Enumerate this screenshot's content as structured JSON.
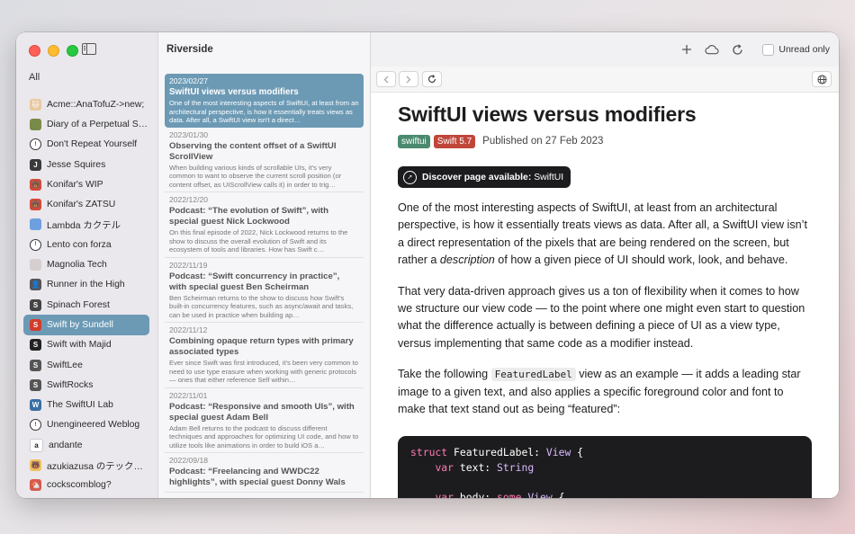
{
  "sidebar": {
    "all_label": "All",
    "feeds": [
      {
        "label": "Acme::AnaTofuZ->new;",
        "icon": "acme-icon",
        "color": "#e8c9a0",
        "glyph": "🐱"
      },
      {
        "label": "Diary of a Perpetual S…",
        "icon": "diary-icon",
        "color": "#7a8a4a",
        "glyph": ""
      },
      {
        "label": "Don't Repeat Yourself",
        "icon": "ring-icon",
        "color": "#ffffff",
        "glyph": "!"
      },
      {
        "label": "Jesse Squires",
        "icon": "jesse-icon",
        "color": "#3a3a3a",
        "glyph": "J"
      },
      {
        "label": "Konifar's WIP",
        "icon": "konifar-icon",
        "color": "#d34a3a",
        "glyph": "🐻"
      },
      {
        "label": "Konifar's ZATSU",
        "icon": "konifar-icon",
        "color": "#d34a3a",
        "glyph": "🐻"
      },
      {
        "label": "Lambda カクテル",
        "icon": "lambda-icon",
        "color": "#6ea0e0",
        "glyph": ""
      },
      {
        "label": "Lento con forza",
        "icon": "ring-icon",
        "color": "#ffffff",
        "glyph": "!"
      },
      {
        "label": "Magnolia Tech",
        "icon": "magnolia-icon",
        "color": "#d5cfcf",
        "glyph": ""
      },
      {
        "label": "Runner in the High",
        "icon": "runner-icon",
        "color": "#555555",
        "glyph": "👤"
      },
      {
        "label": "Spinach Forest",
        "icon": "spinach-icon",
        "color": "#444444",
        "glyph": "S"
      },
      {
        "label": "Swift by Sundell",
        "icon": "sundell-icon",
        "color": "#d33b2a",
        "glyph": "S"
      },
      {
        "label": "Swift with Majid",
        "icon": "majid-icon",
        "color": "#222222",
        "glyph": "S"
      },
      {
        "label": "SwiftLee",
        "icon": "swiftlee-icon",
        "color": "#555555",
        "glyph": "S"
      },
      {
        "label": "SwiftRocks",
        "icon": "swiftrocks-icon",
        "color": "#555555",
        "glyph": "S"
      },
      {
        "label": "The SwiftUI Lab",
        "icon": "wordpress-icon",
        "color": "#3a6ea5",
        "glyph": "W"
      },
      {
        "label": "Unengineered Weblog",
        "icon": "ring-icon",
        "color": "#ffffff",
        "glyph": "!"
      },
      {
        "label": "andante",
        "icon": "andante-icon",
        "color": "#ffffff",
        "glyph": "a"
      },
      {
        "label": "azukiazusa のテックブ…",
        "icon": "azuki-icon",
        "color": "#f0c060",
        "glyph": "🐻"
      },
      {
        "label": "cockscomblog?",
        "icon": "cockscomb-icon",
        "color": "#d55a4a",
        "glyph": "🐔"
      }
    ],
    "selected_index": 11
  },
  "list": {
    "title": "Riverside",
    "articles": [
      {
        "date": "2023/02/27",
        "title": "SwiftUI views versus modifiers",
        "summary": "One of the most interesting aspects of SwiftUI, at least from an architectural perspective, is how it essentially treats views as data. After all, a SwiftUI view isn't a direct…",
        "selected": true
      },
      {
        "date": "2023/01/30",
        "title": "Observing the content offset of a SwiftUI ScrollView",
        "summary": "When building various kinds of scrollable UIs, it's very common to want to observe the current scroll position (or content offset, as UIScrollView calls it) in order to trig…"
      },
      {
        "date": "2022/12/20",
        "title": "Podcast: “The evolution of Swift”, with special guest Nick Lockwood",
        "summary": "On this final episode of 2022, Nick Lockwood returns to the show to discuss the overall evolution of Swift and its ecosystem of tools and libraries. How has Swift c…"
      },
      {
        "date": "2022/11/19",
        "title": "Podcast: “Swift concurrency in practice”, with special guest Ben Scheirman",
        "summary": "Ben Scheirman returns to the show to discuss how Swift's built-in concurrency features, such as async/await and tasks, can be used in practice when building ap…"
      },
      {
        "date": "2022/11/12",
        "title": "Combining opaque return types with primary associated types",
        "summary": "Ever since Swift was first introduced, it's been very common to need to use type erasure when working with generic protocols — ones that either reference Self within…"
      },
      {
        "date": "2022/11/01",
        "title": "Podcast: “Responsive and smooth UIs”, with special guest Adam Bell",
        "summary": "Adam Bell returns to the podcast to discuss different techniques and approaches for optimizing UI code, and how to utilize tools like animations in order to build iOS a…"
      },
      {
        "date": "2022/09/18",
        "title": "Podcast: “Freelancing and WWDC22 highlights”, with special guest Donny Wals",
        "summary": ""
      }
    ]
  },
  "toolbar": {
    "unread_label": "Unread only",
    "icons": [
      "plus-icon",
      "cloud-icon",
      "refresh-icon"
    ]
  },
  "article": {
    "title": "SwiftUI views versus modifiers",
    "tags": [
      {
        "label": "swiftui",
        "color": "#4a8a6e"
      },
      {
        "label": "Swift 5.7",
        "color": "#c0463a"
      }
    ],
    "published": "Published on 27 Feb 2023",
    "discover_label": "Discover page available:",
    "discover_value": "SwiftUI",
    "p1_a": "One of the most interesting aspects of SwiftUI, at least from an architectural perspective, is how it essentially treats views as data. After all, a SwiftUI view isn’t a direct representation of the pixels that are being rendered on the screen, but rather a ",
    "p1_em": "description",
    "p1_b": " of how a given piece of UI should work, look, and behave.",
    "p2": "That very data-driven approach gives us a ton of flexibility when it comes to how we structure our view code — to the point where one might even start to question what the difference actually is between defining a piece of UI as a view type, versus implementing that same code as a modifier instead.",
    "p3_a": "Take the following ",
    "p3_code": "FeaturedLabel",
    "p3_b": " view as an example — it adds a leading star image to a given text, and also applies a specific foreground color and font to make that text stand out as being “featured”:",
    "code": {
      "l1_kw": "struct",
      "l1_name": " FeaturedLabel: ",
      "l1_type": "View",
      "l1_end": " {",
      "l2_kw": "var",
      "l2_name": " text: ",
      "l2_type": "String",
      "l4_kw": "var",
      "l4_name": " body: ",
      "l4_kw2": "some",
      "l4_type": " View",
      "l4_end": " {"
    }
  }
}
